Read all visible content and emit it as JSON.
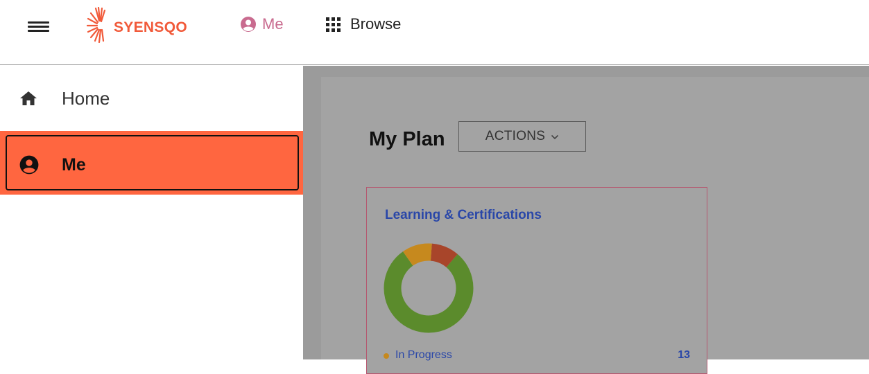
{
  "header": {
    "brand": "SYENSQO",
    "nav_me_label": "Me",
    "nav_browse_label": "Browse"
  },
  "sidebar": {
    "items": [
      {
        "label": "Home",
        "icon": "home-icon",
        "selected": false
      },
      {
        "label": "Me",
        "icon": "account-circle-icon",
        "selected": true
      }
    ]
  },
  "main": {
    "title": "My Plan",
    "actions_label": "ACTIONS",
    "card": {
      "title": "Learning & Certifications",
      "legend": [
        {
          "label": "In Progress",
          "count": "13",
          "color": "#c6891e"
        }
      ]
    }
  },
  "chart_data": {
    "type": "pie",
    "title": "",
    "series": [
      {
        "values": [
          0.79,
          0.1,
          0.11
        ],
        "colors": [
          "#5b8b2c",
          "#a8452a",
          "#c6891e"
        ]
      }
    ]
  },
  "colors": {
    "accent": "#ff6640",
    "brand": "#f15a3a",
    "link": "#2a47a8",
    "nav_active": "#c96b8f"
  }
}
